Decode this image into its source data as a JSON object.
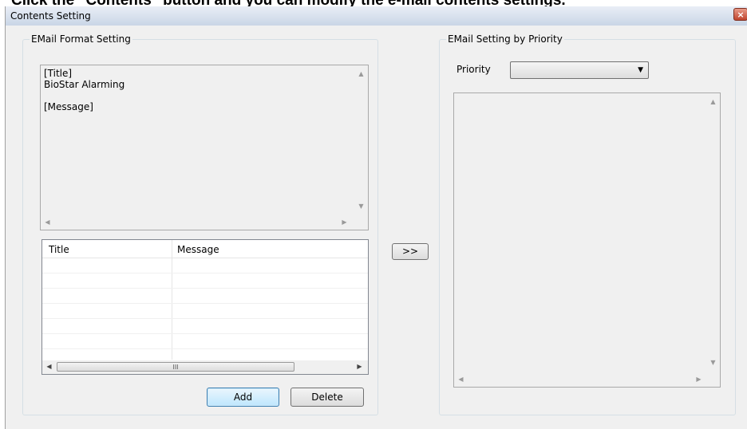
{
  "overlay": {
    "text": "Click the \"Contents\" button and you can modify the e-mail contents settings."
  },
  "window": {
    "title": "Contents Setting",
    "close_label": "×"
  },
  "email_format": {
    "caption": "EMail Format Setting",
    "preview_text": "[Title]\nBioStar Alarming\n\n[Message]",
    "list": {
      "columns": [
        "Title",
        "Message"
      ],
      "rows": []
    },
    "add_label": "Add",
    "delete_label": "Delete"
  },
  "transfer_label": ">>",
  "email_priority": {
    "caption": "EMail Setting by Priority",
    "priority_label": "Priority",
    "priority_value": ""
  },
  "scroll": {
    "grip": "III"
  }
}
